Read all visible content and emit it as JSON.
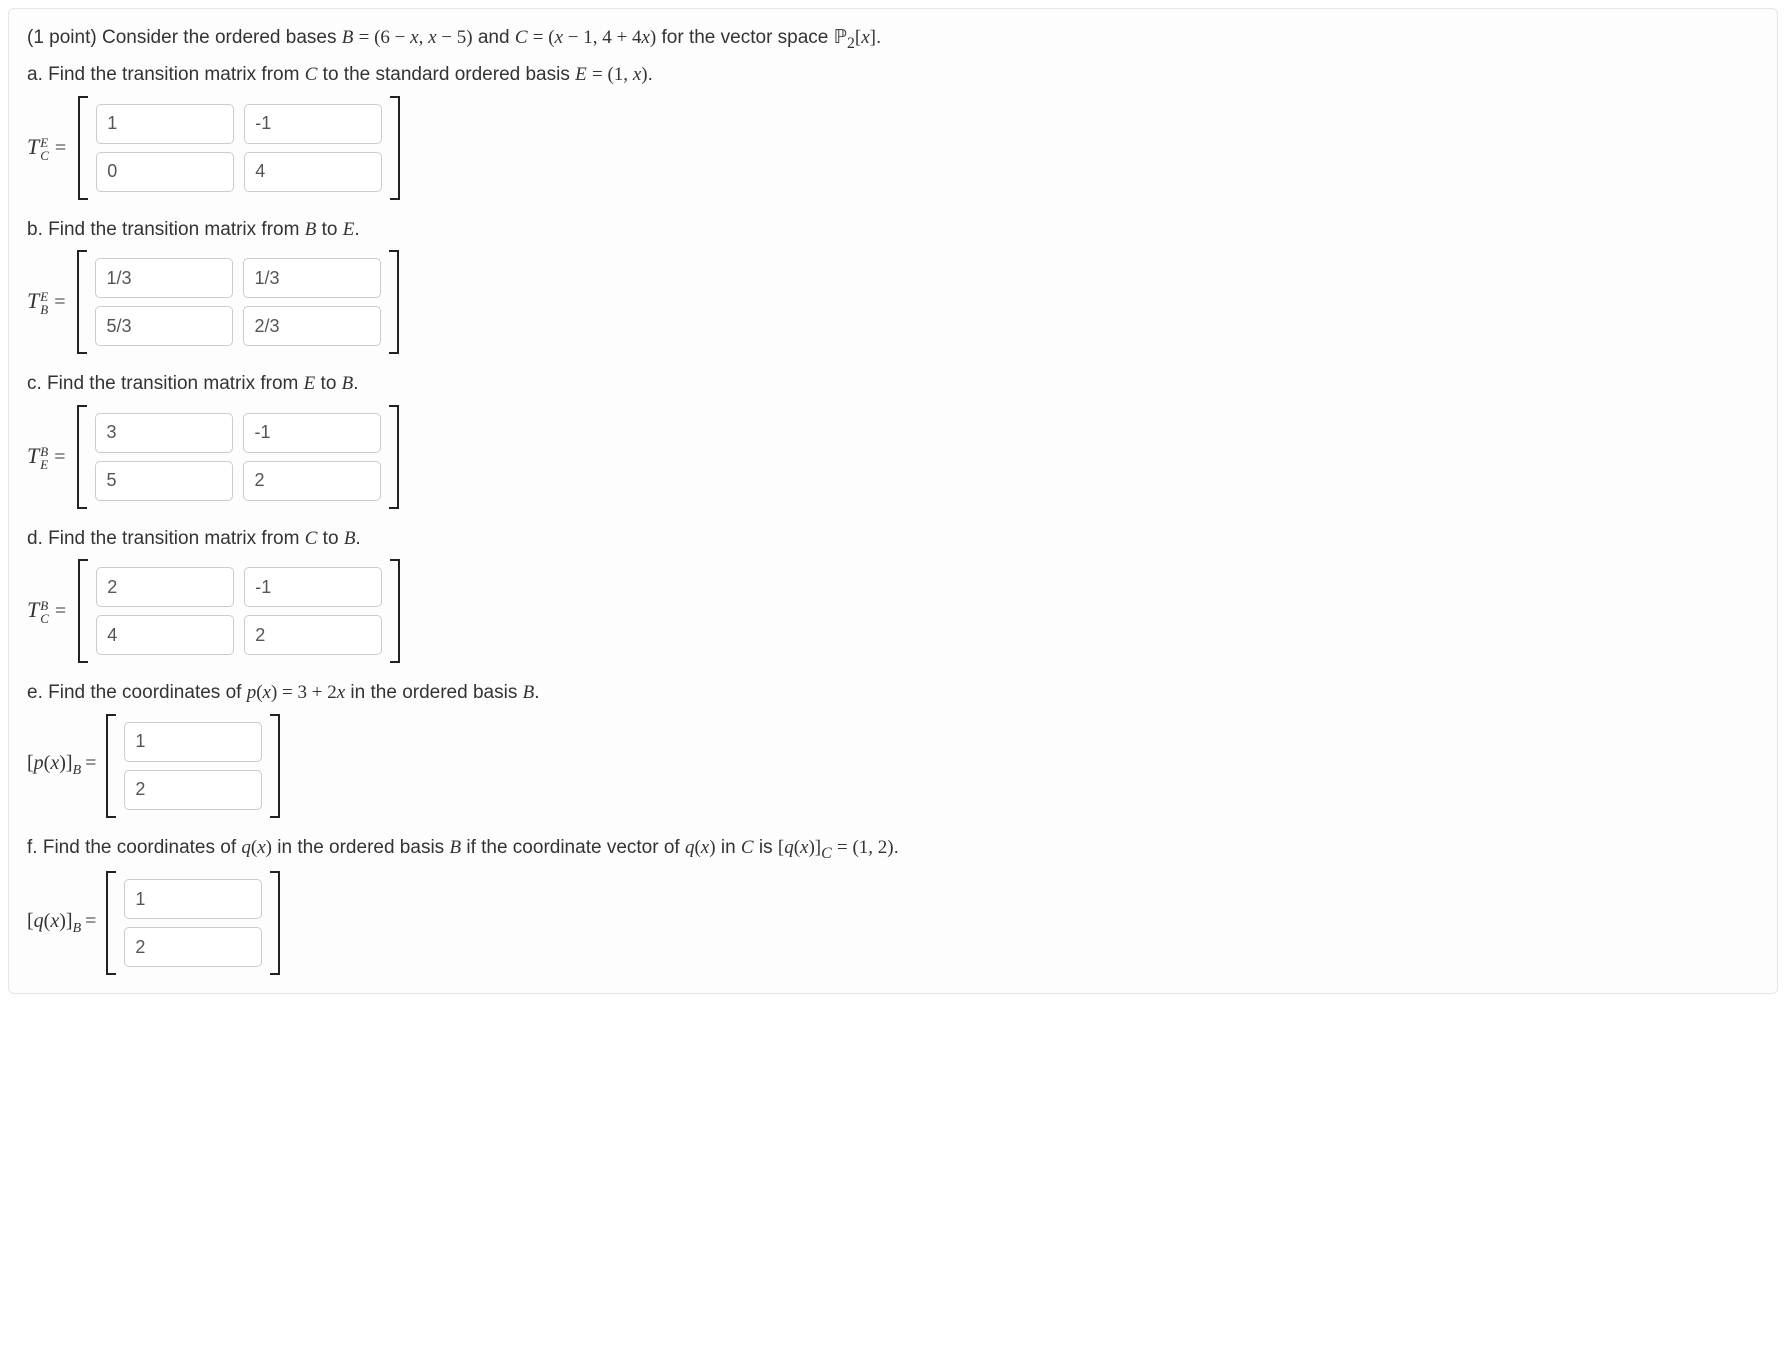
{
  "intro_line1_html": "(1 point) Consider the ordered bases <span class='math'>B</span> <span class='mathup'>= (6 − </span><span class='math'>x</span><span class='mathup'>, </span><span class='math'>x</span><span class='mathup'> − 5)</span> and <span class='math'>C</span> <span class='mathup'>= (</span><span class='math'>x</span><span class='mathup'> − 1, 4 + 4</span><span class='math'>x</span><span class='mathup'>)</span> for the vector space <span class='bb'>ℙ</span><span class='mathup'><sub>2</sub>[</span><span class='math'>x</span><span class='mathup'>]</span>.",
  "intro_line2_html": "a. Find the transition matrix from <span class='math'>C</span> to the standard ordered basis <span class='math'>E</span> <span class='mathup'>= (1, </span><span class='math'>x</span><span class='mathup'>)</span>.",
  "parts": {
    "a": {
      "label_sup": "E",
      "label_sub": "C",
      "vals": [
        "1",
        "-1",
        "0",
        "4"
      ]
    },
    "b": {
      "prompt_html": "b. Find the transition matrix from <span class='math'>B</span> to <span class='math'>E</span>.",
      "label_sup": "E",
      "label_sub": "B",
      "vals": [
        "1/3",
        "1/3",
        "5/3",
        "2/3"
      ]
    },
    "c": {
      "prompt_html": "c. Find the transition matrix from <span class='math'>E</span> to <span class='math'>B</span>.",
      "label_sup": "B",
      "label_sub": "E",
      "vals": [
        "3",
        "-1",
        "5",
        "2"
      ]
    },
    "d": {
      "prompt_html": "d. Find the transition matrix from <span class='math'>C</span> to <span class='math'>B</span>.",
      "label_sup": "B",
      "label_sub": "C",
      "vals": [
        "2",
        "-1",
        "4",
        "2"
      ]
    },
    "e": {
      "prompt_html": "e. Find the coordinates of <span class='math'>p</span><span class='mathup'>(</span><span class='math'>x</span><span class='mathup'>) = 3 + 2</span><span class='math'>x</span> in the ordered basis <span class='math'>B</span>.",
      "veclabel_html": "[<span class='math'>p</span>(<span class='math'>x</span>)]<span class='sub'>B</span>",
      "vals": [
        "1",
        "2"
      ]
    },
    "f": {
      "prompt_html": "f. Find the coordinates of <span class='math'>q</span><span class='mathup'>(</span><span class='math'>x</span><span class='mathup'>)</span> in the ordered basis <span class='math'>B</span> if the coordinate vector of <span class='math'>q</span><span class='mathup'>(</span><span class='math'>x</span><span class='mathup'>)</span> in <span class='math'>C</span> is <span class='mathup'>[</span><span class='math'>q</span><span class='mathup'>(</span><span class='math'>x</span><span class='mathup'>)]</span><span class='math'><sub>C</sub></span> <span class='mathup'>= (1, 2)</span>.",
      "veclabel_html": "[<span class='math'>q</span>(<span class='math'>x</span>)]<span class='sub'>B</span>",
      "vals": [
        "1",
        "2"
      ]
    }
  }
}
